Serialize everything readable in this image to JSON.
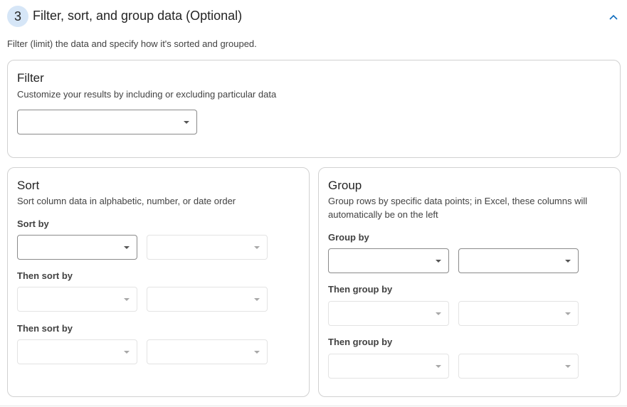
{
  "section": {
    "step_number": "3",
    "title": "Filter, sort, and group data (Optional)",
    "description": "Filter (limit) the data and specify how it's sorted and grouped.",
    "collapse_icon": "chevron-up-icon",
    "accent_color": "#0f6cbd"
  },
  "filter": {
    "title": "Filter",
    "description": "Customize your results by including or excluding particular data",
    "dropdown_value": ""
  },
  "sort": {
    "title": "Sort",
    "description": "Sort column data in alphabetic, number, or date order",
    "rows": [
      {
        "label": "Sort by",
        "column_value": "",
        "order_value": ""
      },
      {
        "label": "Then sort by",
        "column_value": "",
        "order_value": ""
      },
      {
        "label": "Then sort by",
        "column_value": "",
        "order_value": ""
      }
    ]
  },
  "group": {
    "title": "Group",
    "description_line1": "Group rows by specific data points; in Excel, these columns will",
    "description_line2": "automatically be on the left",
    "rows": [
      {
        "label": "Group by",
        "column_value": "",
        "option_value": ""
      },
      {
        "label": "Then group by",
        "column_value": "",
        "option_value": ""
      },
      {
        "label": "Then group by",
        "column_value": "",
        "option_value": ""
      }
    ]
  }
}
